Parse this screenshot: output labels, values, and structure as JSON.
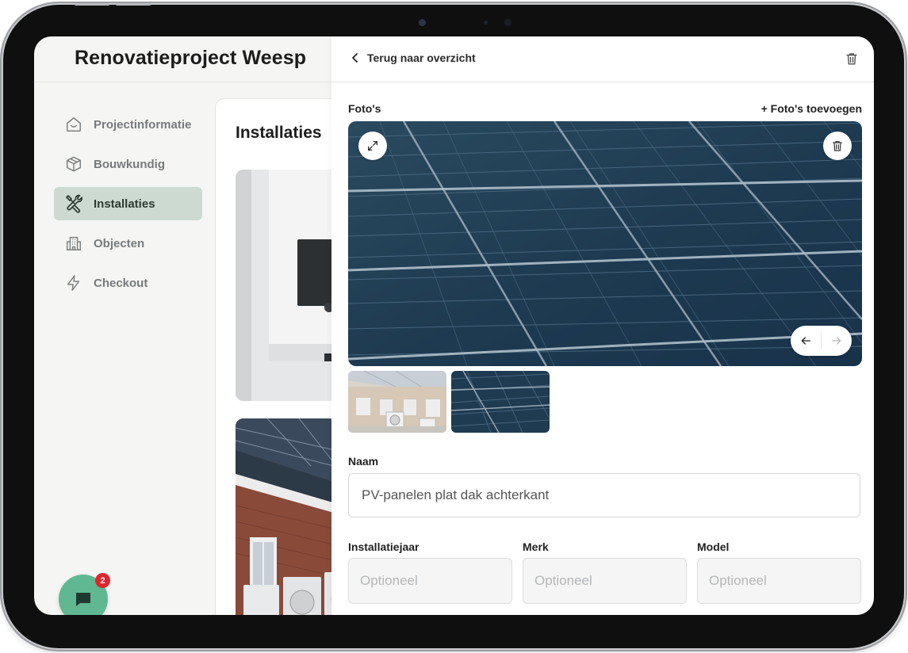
{
  "project": {
    "title": "Renovatieproject Weesp"
  },
  "sidebar": {
    "items": [
      {
        "label": "Projectinformatie",
        "icon": "home-icon",
        "active": false
      },
      {
        "label": "Bouwkundig",
        "icon": "box-icon",
        "active": false
      },
      {
        "label": "Installaties",
        "icon": "tools-icon",
        "active": true
      },
      {
        "label": "Objecten",
        "icon": "building-icon",
        "active": false
      },
      {
        "label": "Checkout",
        "icon": "lightning-icon",
        "active": false
      }
    ]
  },
  "main": {
    "title": "Installaties"
  },
  "chat": {
    "badge": "2",
    "icon": "chat-icon",
    "color": "#5fb892",
    "badge_color": "#e0262d"
  },
  "panel": {
    "back_label": "Terug naar overzicht",
    "photos": {
      "label": "Foto's",
      "add_label": "+ Foto's toevoegen",
      "thumbnails": [
        "house-with-heatpumps",
        "solar-panels"
      ],
      "selected_index": 1
    },
    "fields": {
      "naam_label": "Naam",
      "naam_value": "PV-panelen plat dak achterkant",
      "jaar_label": "Installatiejaar",
      "jaar_placeholder": "Optioneel",
      "merk_label": "Merk",
      "merk_placeholder": "Optioneel",
      "model_label": "Model",
      "model_placeholder": "Optioneel"
    }
  },
  "colors": {
    "accent_active_bg": "#ccdad1",
    "screen_bg": "#f5f5f3"
  }
}
